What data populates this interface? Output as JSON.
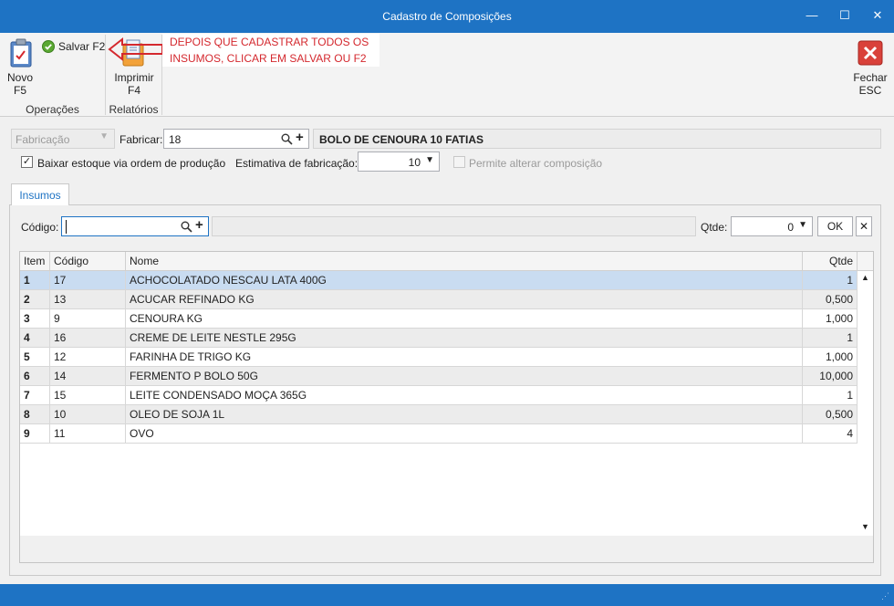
{
  "window": {
    "title": "Cadastro de Composições",
    "minimize_glyph": "—",
    "maximize_glyph": "☐",
    "close_glyph": "✕"
  },
  "ribbon": {
    "novo_label": "Novo",
    "novo_shortcut": "F5",
    "salvar_label": "Salvar F2",
    "operacoes_group": "Operações",
    "imprimir_label": "Imprimir",
    "imprimir_shortcut": "F4",
    "relatorios_group": "Relatórios",
    "fechar_label": "Fechar",
    "fechar_shortcut": "ESC",
    "annotation_line1": "DEPOIS QUE CADASTRAR TODOS OS",
    "annotation_line2": "INSUMOS, CLICAR EM SALVAR OU F2",
    "annotation_color": "#d4282e"
  },
  "form": {
    "tipo_value": "Fabricação",
    "fabricar_label": "Fabricar:",
    "fabricar_value": "18",
    "produto_nome": "BOLO DE CENOURA 10 FATIAS",
    "baixar_estoque_label": "Baixar estoque via ordem de produção",
    "baixar_estoque_checked": true,
    "estimativa_label": "Estimativa de fabricação:",
    "estimativa_value": "10",
    "permite_alterar_label": "Permite alterar composição",
    "permite_alterar_checked": false
  },
  "insumos": {
    "tab_label": "Insumos",
    "codigo_label": "Código:",
    "codigo_value": "",
    "descricao_value": "",
    "qtde_label": "Qtde:",
    "qtde_value": "0",
    "ok_label": "OK",
    "remove_glyph": "✕"
  },
  "table": {
    "columns": [
      "Item",
      "Código",
      "Nome",
      "Qtde"
    ],
    "rows": [
      {
        "item": "1",
        "codigo": "17",
        "nome": "ACHOCOLATADO NESCAU LATA 400G",
        "qtde": "1"
      },
      {
        "item": "2",
        "codigo": "13",
        "nome": "ACUCAR REFINADO KG",
        "qtde": "0,500"
      },
      {
        "item": "3",
        "codigo": "9",
        "nome": "CENOURA KG",
        "qtde": "1,000"
      },
      {
        "item": "4",
        "codigo": "16",
        "nome": "CREME DE LEITE NESTLE 295G",
        "qtde": "1"
      },
      {
        "item": "5",
        "codigo": "12",
        "nome": "FARINHA DE TRIGO KG",
        "qtde": "1,000"
      },
      {
        "item": "6",
        "codigo": "14",
        "nome": "FERMENTO P BOLO 50G",
        "qtde": "10,000"
      },
      {
        "item": "7",
        "codigo": "15",
        "nome": "LEITE CONDENSADO MOÇA 365G",
        "qtde": "1"
      },
      {
        "item": "8",
        "codigo": "10",
        "nome": "OLEO DE SOJA 1L",
        "qtde": "0,500"
      },
      {
        "item": "9",
        "codigo": "11",
        "nome": "OVO",
        "qtde": "4"
      }
    ]
  },
  "colors": {
    "accent": "#1e73c4",
    "selected_row": "#c9dcf1",
    "close_button": "#d9413a"
  },
  "icons": {
    "novo": "clipboard-check-icon",
    "salvar": "green-check-icon",
    "imprimir": "printer-document-icon",
    "fechar": "close-red-icon",
    "arrow": "left-arrow-outline-icon",
    "search": "search-icon",
    "add": "plus-icon"
  }
}
